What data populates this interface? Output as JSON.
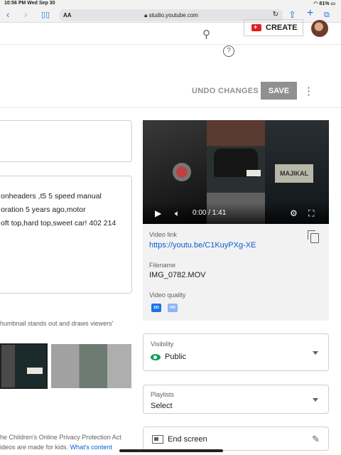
{
  "status_bar": {
    "time": "10:56 PM  Wed Sep 30",
    "battery": "81%"
  },
  "browser": {
    "aa": "AA",
    "url": "studio.youtube.com"
  },
  "header": {
    "create_label": "CREATE"
  },
  "actions": {
    "undo_label": "UNDO CHANGES",
    "save_label": "SAVE"
  },
  "description": {
    "lines": [
      "onheaders ,t5 5 speed manual",
      "oration 5 years ago,motor",
      "oft top,hard top,sweet car! 402 214"
    ]
  },
  "thumbnail": {
    "hint": "humbnail stands out and draws viewers'"
  },
  "audience": {
    "line1": "he Children's Online Privacy Protection Act",
    "line2_text": "ideos are made for kids. ",
    "line2_link": "What's content"
  },
  "video": {
    "time": "0:00 / 1:41",
    "plate_text": "MAJIKAL",
    "link_label": "Video link",
    "link_url": "https://youtu.be/C1KuyPXg-XE",
    "filename_label": "Filename",
    "filename": "IMG_0782.MOV",
    "quality_label": "Video quality",
    "quality_badges": [
      "SD",
      "HD"
    ]
  },
  "visibility": {
    "label": "Visibility",
    "value": "Public"
  },
  "playlists": {
    "label": "Playlists",
    "value": "Select"
  },
  "end_screen": {
    "label": "End screen"
  },
  "icons": {
    "search": "search-icon",
    "help": "help-icon",
    "more": "more-vert-icon",
    "play": "play-icon",
    "volume": "volume-icon",
    "settings": "gear-icon",
    "fullscreen": "fullscreen-icon",
    "copy": "copy-icon",
    "edit": "pencil-icon"
  },
  "colors": {
    "link": "#065fd4",
    "save_disabled": "#909090",
    "public_green": "#0f9d58",
    "create_red": "#e02020"
  }
}
